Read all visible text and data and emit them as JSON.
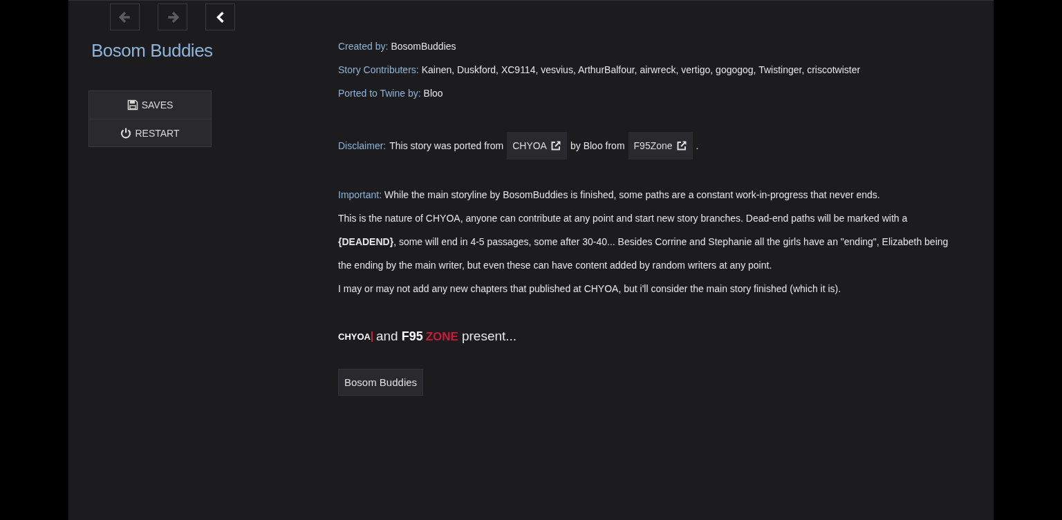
{
  "nav": [
    {
      "kind": "back",
      "disabled": true
    },
    {
      "kind": "forward",
      "disabled": true
    },
    {
      "kind": "collapse",
      "disabled": false
    }
  ],
  "story_title": "Bosom Buddies",
  "menu": [
    {
      "kind": "saves",
      "label": "SAVES"
    },
    {
      "kind": "restart",
      "label": "RESTART"
    }
  ],
  "credits": [
    {
      "label": "Created by:",
      "value": "BosomBuddies"
    },
    {
      "label": "Story Contributers:",
      "value": "Kainen, Duskford, XC9114, vesvius, ArthurBalfour, airwreck, vertigo, gogogog, Twistinger, criscotwister"
    },
    {
      "label": "Ported to Twine by:",
      "value": "Bloo"
    }
  ],
  "disclaimer": {
    "label": "Disclaimer:",
    "text_1": "This story was ported from",
    "link_1": "CHYOA",
    "text_2": "by Bloo from",
    "link_2": "F95Zone",
    "text_3": "."
  },
  "important": {
    "label": "Important:",
    "lines": [
      "While the main storyline by BosomBuddies is finished, some paths are a constant work-in-progress that never ends.",
      "This is the nature of CHYOA, anyone can contribute at any point and start new story branches. Dead-end paths will be marked with a **{DEADEND}**, some will end in 4-5 passages, some after 30-40... Besides Corrine and Stephanie all the girls have an \"ending\", Elizabeth being the ending by the main writer, but even these can have content added by random writers at any point.",
      "I may or may not add any new chapters that published at CHYOA, but i'll consider the main story finished (which it is)."
    ]
  },
  "present": {
    "logo_1": "CHYOA",
    "joiner": "and",
    "logo_2a": "F95",
    "logo_2b": "ZONE",
    "text": "present..."
  },
  "start_button": "Bosom Buddies"
}
